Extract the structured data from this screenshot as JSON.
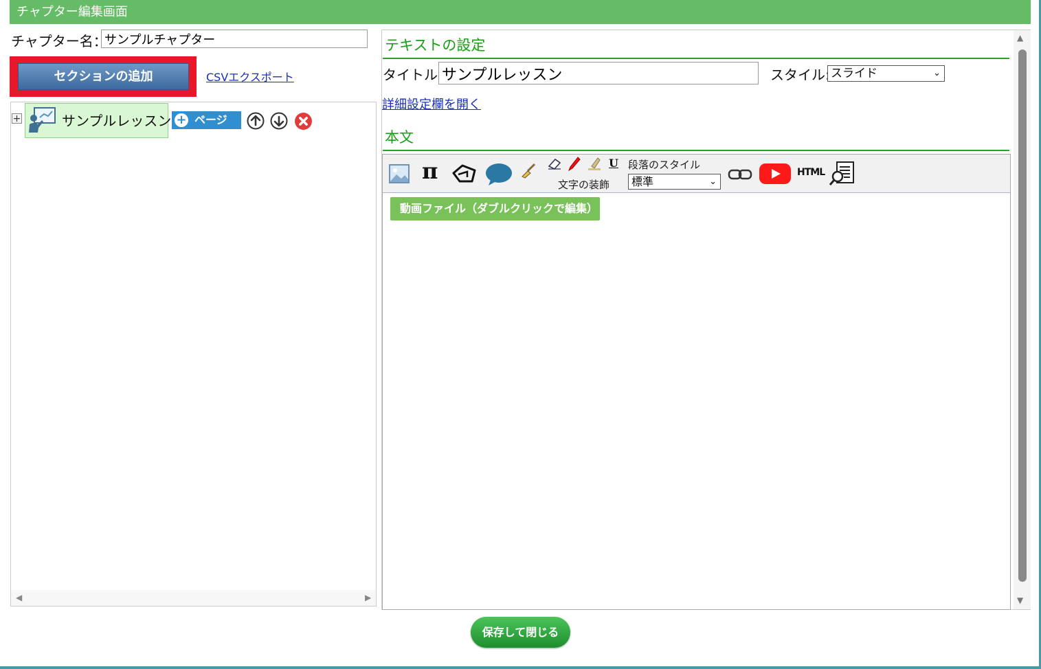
{
  "header": {
    "title": "チャプター編集画面"
  },
  "left": {
    "chapter_label": "チャプター名：",
    "chapter_name_value": "サンプルチャプター",
    "add_section_label": "セクションの追加",
    "csv_export_label": "CSVエクスポート",
    "tree": {
      "expand_glyph": "+",
      "lesson_label": "サンプルレッスン",
      "page_button_label": "ページ"
    }
  },
  "right": {
    "text_settings_heading": "テキストの設定",
    "title_label": "タイトル:",
    "title_value": "サンプルレッスン",
    "style_label": "スタイル:",
    "style_selected": "スライド",
    "detail_link": "詳細設定欄を開く",
    "body_heading": "本文",
    "toolbar": {
      "underline_glyph": "U",
      "text_decoration_label": "文字の装飾",
      "paragraph_style_label": "段落のスタイル",
      "paragraph_style_selected": "標準",
      "pi_glyph": "π",
      "html_label": "HTML"
    },
    "video_chip_label": "動画ファイル（ダブルクリックで編集）"
  },
  "footer": {
    "save_close_label": "保存して閉じる"
  },
  "colors": {
    "title_bar": "#66bb66",
    "heading_green": "#13a113",
    "highlight_red": "#e8182a",
    "page_button_blue": "#2f8fd1",
    "save_button_green": "#1d8e2c"
  }
}
